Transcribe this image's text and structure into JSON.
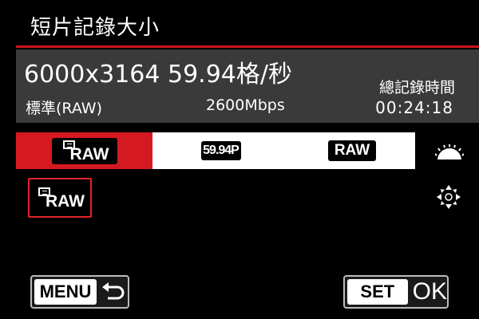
{
  "header": {
    "title": "短片記錄大小"
  },
  "info": {
    "spec": "6000x3164 59.94格/秒",
    "quality": "標準(RAW)",
    "bitrate": "2600Mbps",
    "total_label": "總記錄時間",
    "total_time": "00:24:18"
  },
  "tabs": [
    {
      "label": "RAW",
      "icon": "raw-movie-icon",
      "active": true
    },
    {
      "label": "59.94P",
      "active": false
    },
    {
      "label": "RAW",
      "active": false
    }
  ],
  "selection": {
    "label": "RAW",
    "icon": "raw-movie-icon"
  },
  "footer": {
    "menu_label": "MENU",
    "set_label": "SET",
    "ok_label": "OK"
  },
  "colors": {
    "accent": "#d51920",
    "panel": "#3a3a3a",
    "background": "#000000"
  },
  "icons": [
    "main-dial-icon",
    "multi-controller-icon",
    "back-arrow-icon"
  ]
}
